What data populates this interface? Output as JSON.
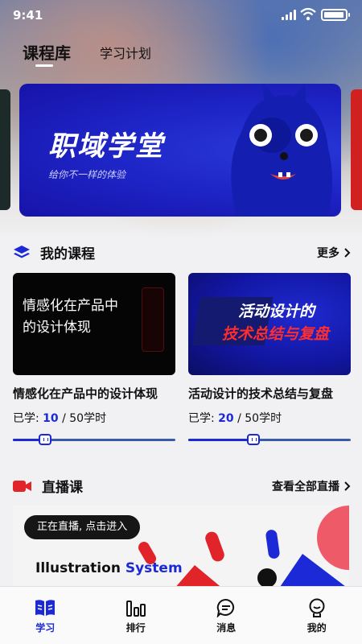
{
  "status_bar": {
    "time": "9:41"
  },
  "top_tabs": [
    {
      "label": "课程库",
      "active": true
    },
    {
      "label": "学习计划",
      "active": false
    }
  ],
  "banner": {
    "title": "职域学堂",
    "subtitle": "给你不一样的体验"
  },
  "my_courses": {
    "title": "我的课程",
    "more": "更多",
    "icon": "layers-icon",
    "courses": [
      {
        "thumb_text": [
          "情感化在产品中",
          "的设计体现"
        ],
        "title": "情感化在产品中的设计体现",
        "learned_label": "已学:",
        "learned": "10",
        "total": "/ 50学时",
        "progress": 0.2
      },
      {
        "thumb_text": [
          "活动设计的",
          "技术总结与复盘"
        ],
        "title": "活动设计的技术总结与复盘",
        "learned_label": "已学:",
        "learned": "20",
        "total": "/ 50学时",
        "progress": 0.4
      }
    ]
  },
  "live": {
    "title": "直播课",
    "more": "查看全部直播",
    "icon": "video-camera-icon",
    "pill": "正在直播, 点击进入",
    "brand_a": "Illustration ",
    "brand_b": "System"
  },
  "bottom_nav": [
    {
      "label": "学习",
      "icon": "book-icon",
      "active": true
    },
    {
      "label": "排行",
      "icon": "bar-chart-icon",
      "active": false
    },
    {
      "label": "消息",
      "icon": "message-icon",
      "active": false
    },
    {
      "label": "我的",
      "icon": "profile-icon",
      "active": false
    }
  ],
  "colors": {
    "accent": "#1b2ad6",
    "live_red": "#e0242a"
  }
}
